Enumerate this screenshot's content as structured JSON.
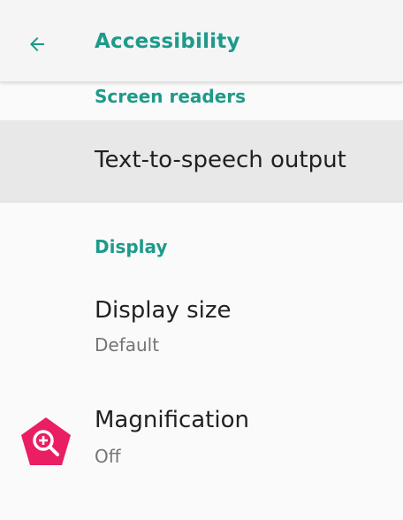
{
  "header": {
    "title": "Accessibility",
    "back_icon": "arrow-back-icon"
  },
  "sections": [
    {
      "category": "Screen readers",
      "items": [
        {
          "title": "Text-to-speech output"
        }
      ]
    },
    {
      "category": "Display",
      "items": [
        {
          "title": "Display size",
          "summary": "Default"
        },
        {
          "title": "Magnification",
          "summary": "Off",
          "icon": "magnification-icon"
        }
      ]
    }
  ],
  "colors": {
    "accent": "#1e9a8a",
    "magnification_icon": "#e91e63",
    "highlight": "#e8e8e8"
  }
}
